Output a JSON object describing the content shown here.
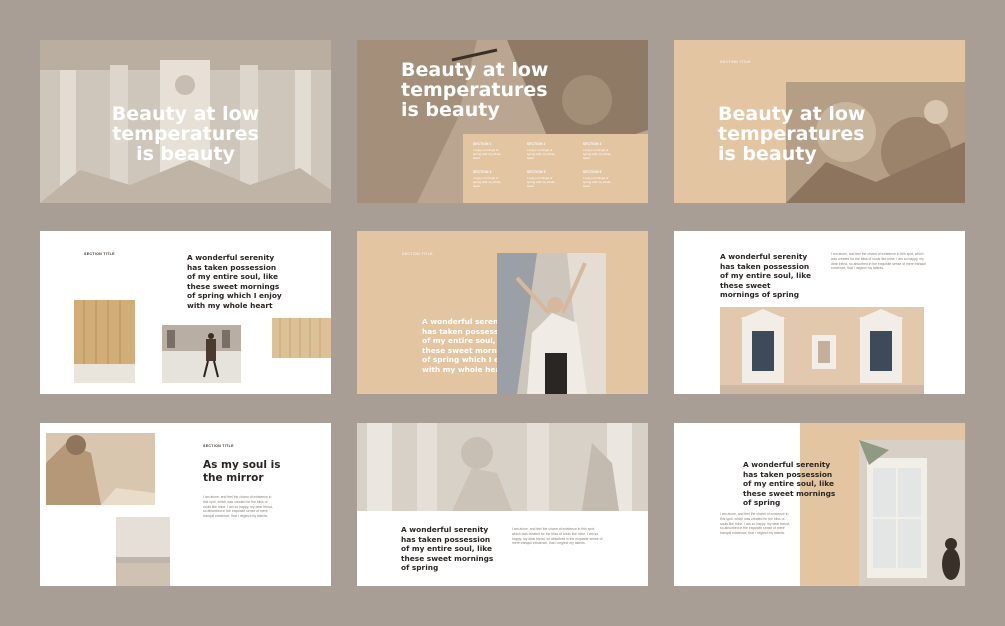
{
  "headline": "Beauty at low temperatures is beauty",
  "section_title": "SECTION TITLE",
  "quote_long": "A wonderful serenity has taken possession of my entire soul, like these sweet mornings of spring which I enjoy with my whole heart",
  "quote_short": "A wonderful serenity has taken possession of my entire soul, like these sweet mornings of spring",
  "mirror_title": "As my soul is the mirror",
  "body_text": "I am alone, and feel the charm of existence in this spot, which was created for the bliss of souls like mine. I am so happy, my dear friend, so absorbed in the exquisite sense of mere tranquil existence, that I neglect my talents.",
  "columns": [
    {
      "title": "SECTION 1",
      "text": "I enjoy mornings of spring with my whole heart"
    },
    {
      "title": "SECTION 2",
      "text": "I enjoy mornings of spring with my whole heart"
    },
    {
      "title": "SECTION 3",
      "text": "I enjoy mornings of spring with my whole heart"
    },
    {
      "title": "SECTION 4",
      "text": "I enjoy mornings of spring with my whole heart"
    },
    {
      "title": "SECTION 5",
      "text": "I enjoy mornings of spring with my whole heart"
    },
    {
      "title": "SECTION 6",
      "text": "I enjoy mornings of spring with my whole heart"
    }
  ],
  "colors": {
    "background": "#a99e95",
    "beige": "#e3c5a2",
    "slide": "#f6f5f3",
    "text": "#2b2623"
  }
}
